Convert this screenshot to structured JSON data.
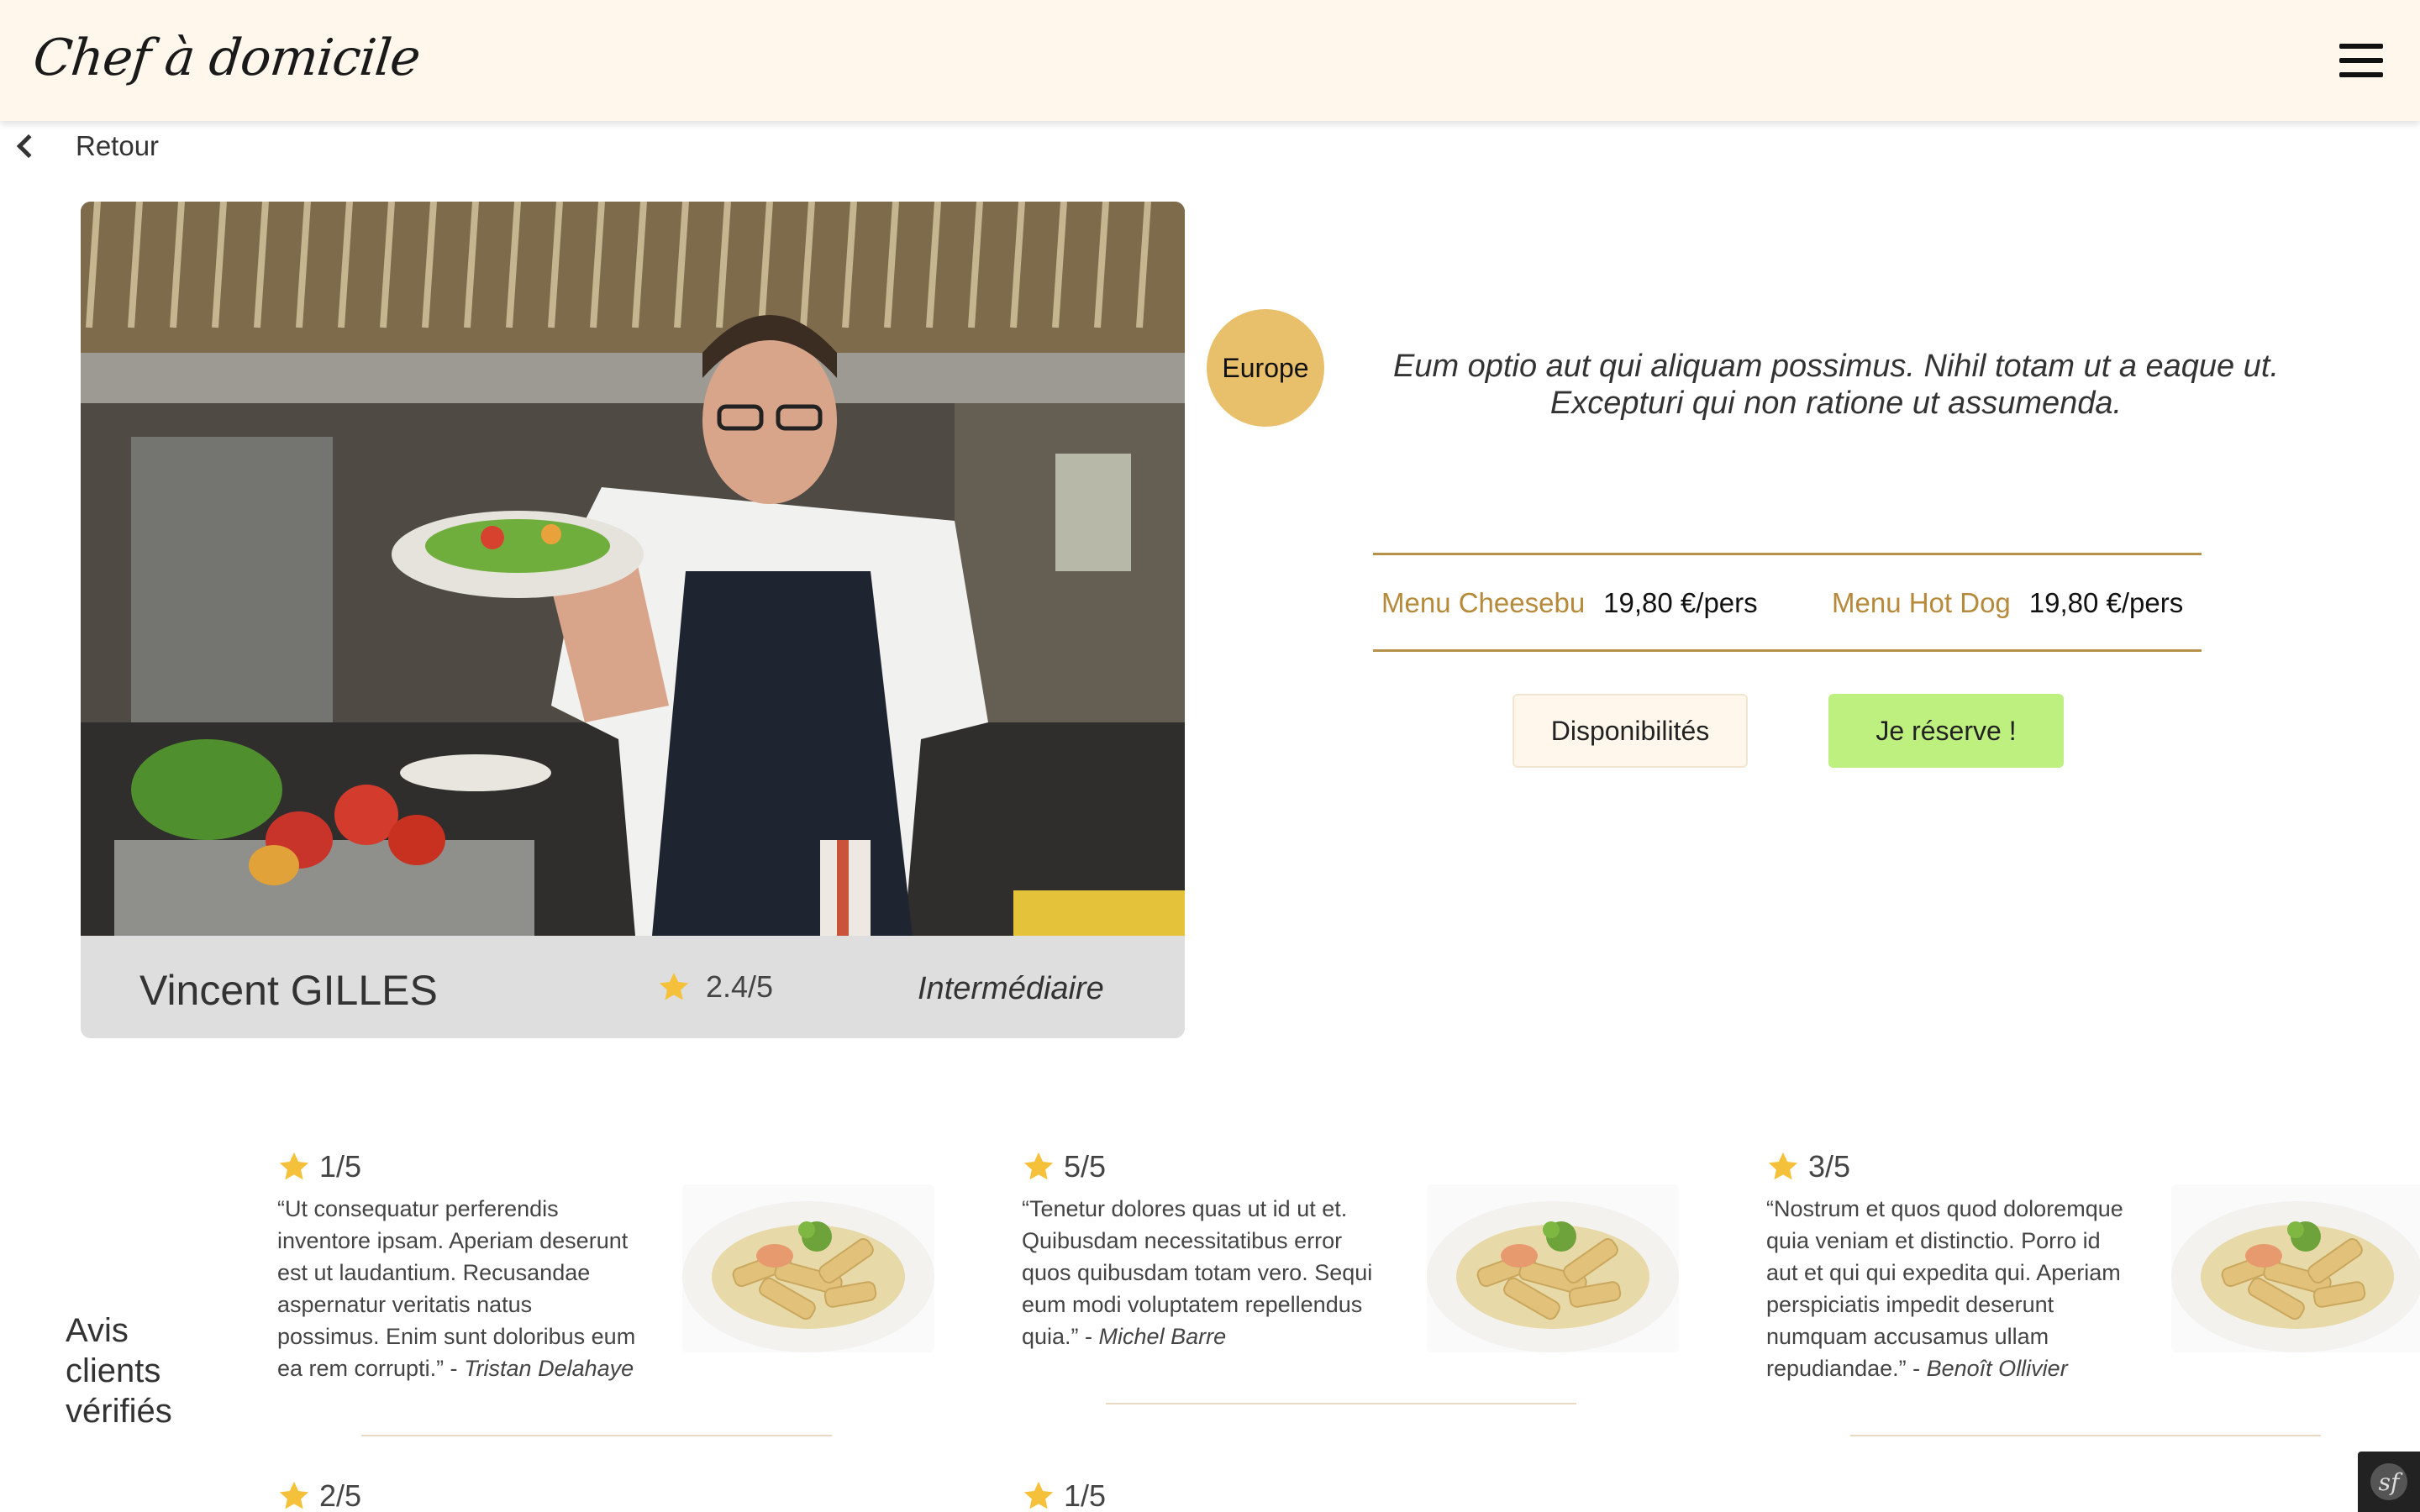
{
  "header": {
    "logo": "Chef à domicile",
    "menu_icon": "hamburger-menu-icon"
  },
  "nav": {
    "back_label": "Retour",
    "back_icon": "chevron-left-icon"
  },
  "chef": {
    "name": "Vincent GILLES",
    "rating": "2.4/5",
    "level": "Intermédiaire",
    "region": "Europe",
    "description": "Eum optio aut qui aliquam possimus. Nihil totam ut a eaque ut. Excepturi qui non ratione ut assumenda.",
    "menus": [
      {
        "name": "Menu Cheesebu",
        "price": "19,80 €/pers"
      },
      {
        "name": "Menu Hot Dog",
        "price": "19,80 €/pers"
      }
    ]
  },
  "actions": {
    "availability_label": "Disponibilités",
    "reserve_label": "Je réserve !"
  },
  "reviews": {
    "title": "Avis clients vérifiés",
    "items": [
      {
        "rating": "1/5",
        "text": "“Ut consequatur perferendis inventore ipsam. Aperiam deserunt est ut laudantium. Recusandae aspernatur veritatis natus possimus. Enim sunt doloribus eum ea rem corrupti.” - ",
        "author": "Tristan Delahaye"
      },
      {
        "rating": "5/5",
        "text": "“Tenetur dolores quas ut id ut et. Quibusdam necessitatibus error quos quibusdam totam vero. Sequi eum modi voluptatem repellendus quia.” - ",
        "author": "Michel Barre"
      },
      {
        "rating": "3/5",
        "text": "“Nostrum et quos quod doloremque quia veniam et distinctio. Porro id aut et qui qui expedita qui. Aperiam perspiciatis impedit deserunt numquam accusamus ullam repudiandae.” - ",
        "author": "Benoît Ollivier"
      },
      {
        "rating": "2/5",
        "text": "",
        "author": ""
      },
      {
        "rating": "1/5",
        "text": "",
        "author": ""
      }
    ]
  },
  "colors": {
    "header_bg": "#fff7ec",
    "accent_gold": "#b68a3a",
    "region_badge": "#e8bf6a",
    "reserve_green": "#bdf07f",
    "star": "#f6c13a"
  }
}
